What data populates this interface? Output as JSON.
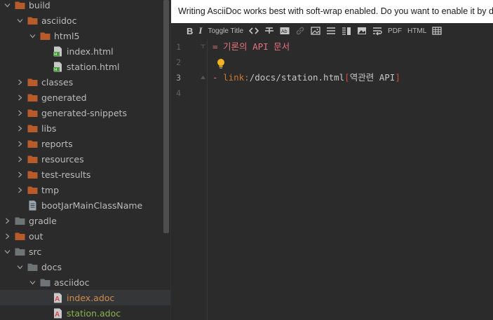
{
  "project_tree": {
    "items": [
      {
        "label": "build",
        "depth": 0,
        "type": "folder-orange",
        "expanded": true
      },
      {
        "label": "asciidoc",
        "depth": 1,
        "type": "folder-orange",
        "expanded": true
      },
      {
        "label": "html5",
        "depth": 2,
        "type": "folder-orange",
        "expanded": true
      },
      {
        "label": "index.html",
        "depth": 3,
        "type": "html-file"
      },
      {
        "label": "station.html",
        "depth": 3,
        "type": "html-file"
      },
      {
        "label": "classes",
        "depth": 1,
        "type": "folder-orange",
        "expanded": false
      },
      {
        "label": "generated",
        "depth": 1,
        "type": "folder-orange",
        "expanded": false
      },
      {
        "label": "generated-snippets",
        "depth": 1,
        "type": "folder-orange",
        "expanded": false
      },
      {
        "label": "libs",
        "depth": 1,
        "type": "folder-orange",
        "expanded": false
      },
      {
        "label": "reports",
        "depth": 1,
        "type": "folder-orange",
        "expanded": false
      },
      {
        "label": "resources",
        "depth": 1,
        "type": "folder-orange",
        "expanded": false
      },
      {
        "label": "test-results",
        "depth": 1,
        "type": "folder-orange",
        "expanded": false
      },
      {
        "label": "tmp",
        "depth": 1,
        "type": "folder-orange",
        "expanded": false
      },
      {
        "label": "bootJarMainClassName",
        "depth": 1,
        "type": "text-file"
      },
      {
        "label": "gradle",
        "depth": 0,
        "type": "folder-gray",
        "expanded": false
      },
      {
        "label": "out",
        "depth": 0,
        "type": "folder-orange",
        "expanded": false
      },
      {
        "label": "src",
        "depth": 0,
        "type": "folder-gray",
        "expanded": true
      },
      {
        "label": "docs",
        "depth": 1,
        "type": "folder-gray",
        "expanded": true
      },
      {
        "label": "asciidoc",
        "depth": 2,
        "type": "folder-gray",
        "expanded": true
      },
      {
        "label": "index.adoc",
        "depth": 3,
        "type": "adoc-file",
        "color": "orange"
      },
      {
        "label": "station.adoc",
        "depth": 3,
        "type": "adoc-file",
        "color": "green"
      }
    ]
  },
  "editor": {
    "banner_text": "Writing AsciiDoc works best with soft-wrap enabled. Do you want to enable it by d",
    "toolbar": {
      "toggle_title_label": "Toggle Title",
      "pdf_label": "PDF",
      "html_label": "HTML",
      "icons": [
        "bold-icon",
        "italic-icon",
        "code-icon",
        "strikethrough-icon",
        "highlight-icon",
        "link-icon",
        "image-icon",
        "list-icon",
        "editor-preview-icon",
        "image-preview-icon",
        "soft-wrap-icon",
        "table-icon"
      ]
    },
    "line_numbers": [
      "1",
      "2",
      "3",
      "4"
    ],
    "current_line": "3",
    "code": {
      "line1": "= 기론의 API 문서",
      "line3_dash": "- ",
      "line3_macro": "link:",
      "line3_target": "/docs/station.html",
      "line3_open": "[",
      "line3_text": "역관련 API",
      "line3_close": "]"
    }
  },
  "colors": {
    "background": "#2b2b2b",
    "folder_orange": "#b75b2a",
    "folder_gray": "#6e7375",
    "heading": "#e5727f",
    "macro": "#cc7832",
    "bracket": "#d04a4a",
    "selected_row": "#343637"
  }
}
